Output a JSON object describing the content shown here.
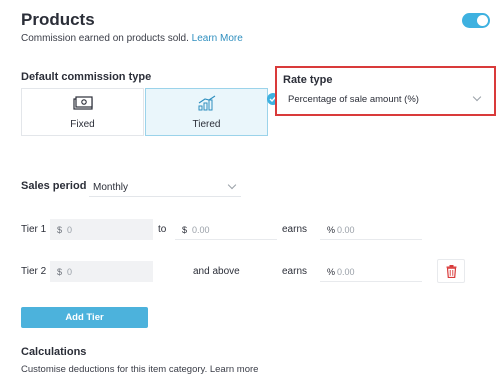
{
  "header": {
    "title": "Products",
    "subtitle": "Commission earned on products sold.",
    "learn_more": "Learn More",
    "toggle_on": true
  },
  "commission_type": {
    "label": "Default commission type",
    "options": [
      {
        "label": "Fixed",
        "icon": "cash-icon",
        "selected": false
      },
      {
        "label": "Tiered",
        "icon": "bar-chart-icon",
        "selected": true
      }
    ]
  },
  "rate_type": {
    "label": "Rate type",
    "value": "Percentage of sale amount (%)"
  },
  "sales_period": {
    "label": "Sales period",
    "value": "Monthly"
  },
  "tiers": [
    {
      "label": "Tier 1",
      "from_symbol": "$",
      "from_placeholder": "0",
      "connector": "to",
      "to_symbol": "$",
      "to_placeholder": "0.00",
      "earns": "earns",
      "pct_symbol": "%",
      "pct_placeholder": "0.00"
    },
    {
      "label": "Tier 2",
      "from_symbol": "$",
      "from_placeholder": "0",
      "connector": "and above",
      "earns": "earns",
      "pct_symbol": "%",
      "pct_placeholder": "0.00"
    }
  ],
  "add_tier_label": "Add Tier",
  "calculations": {
    "title": "Calculations",
    "subtitle": "Customise deductions for this item category. Learn more"
  },
  "colors": {
    "accent": "#3eb1e0",
    "highlight_border": "#d93a3a",
    "delete_icon": "#d93a3a"
  }
}
